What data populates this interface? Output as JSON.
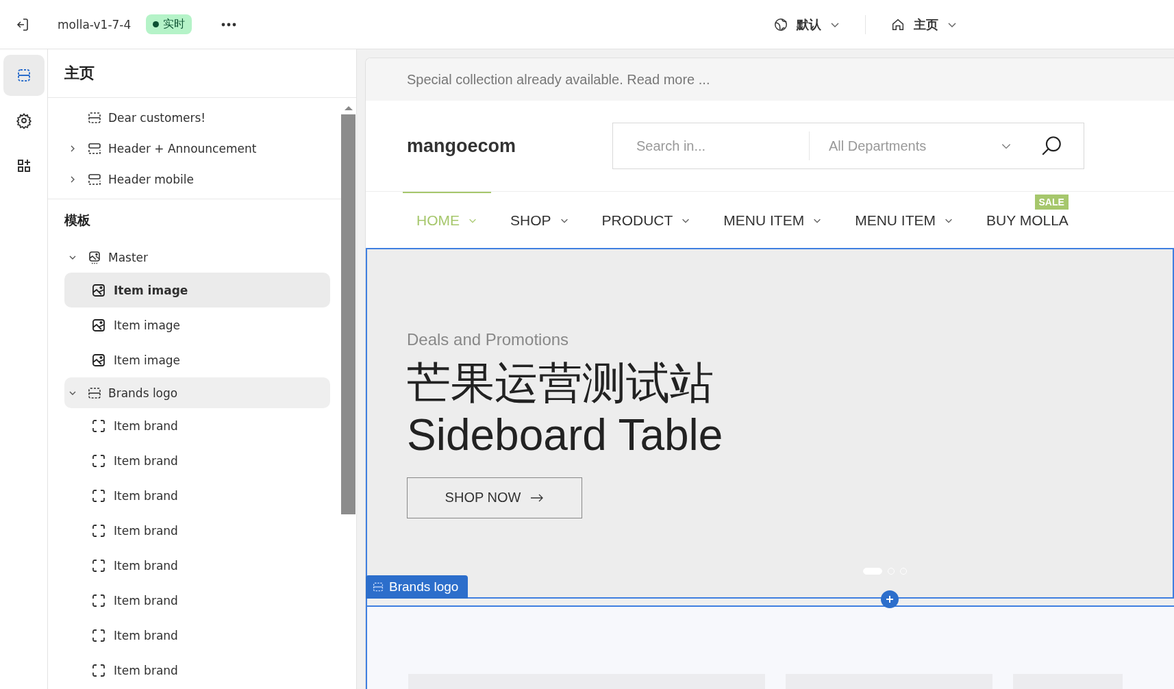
{
  "topbar": {
    "store_name": "molla-v1-7-4",
    "status_badge": "实时",
    "language": "默认",
    "page": "主页"
  },
  "rail": [
    {
      "kind": "sections",
      "selected": true
    },
    {
      "kind": "settings",
      "selected": false
    },
    {
      "kind": "apps",
      "selected": false
    }
  ],
  "sidebar": {
    "title": "主页",
    "sections": [
      {
        "items": [
          {
            "label": "Dear customers!",
            "kind": "section",
            "selected": false
          },
          {
            "label": "Header + Announcement",
            "kind": "header",
            "expanded": false,
            "selected": false
          },
          {
            "label": "Header mobile",
            "kind": "header",
            "expanded": false,
            "selected": false
          }
        ]
      },
      {
        "title": "模板",
        "items": [
          {
            "label": "Master",
            "kind": "master",
            "expanded": true,
            "selected": false,
            "children": [
              {
                "label": "Item image",
                "kind": "image",
                "selected": true
              },
              {
                "label": "Item image",
                "kind": "image",
                "selected": false
              },
              {
                "label": "Item image",
                "kind": "image",
                "selected": false
              }
            ]
          },
          {
            "label": "Brands logo",
            "kind": "section",
            "expanded": true,
            "selected": false,
            "highlighted": true,
            "children": [
              {
                "label": "Item brand",
                "kind": "brand",
                "selected": false
              },
              {
                "label": "Item brand",
                "kind": "brand",
                "selected": false
              },
              {
                "label": "Item brand",
                "kind": "brand",
                "selected": false
              },
              {
                "label": "Item brand",
                "kind": "brand",
                "selected": false
              },
              {
                "label": "Item brand",
                "kind": "brand",
                "selected": false
              },
              {
                "label": "Item brand",
                "kind": "brand",
                "selected": false
              },
              {
                "label": "Item brand",
                "kind": "brand",
                "selected": false
              },
              {
                "label": "Item brand",
                "kind": "brand",
                "selected": false
              }
            ]
          }
        ]
      }
    ]
  },
  "preview": {
    "announcement": "Special collection already available. Read more ...",
    "logo": "mangoecom",
    "search": {
      "placeholder": "Search in...",
      "department": "All Departments"
    },
    "nav": [
      {
        "label": "HOME",
        "selected": true,
        "dropdown": true
      },
      {
        "label": "SHOP",
        "selected": false,
        "dropdown": true
      },
      {
        "label": "PRODUCT",
        "selected": false,
        "dropdown": true
      },
      {
        "label": "MENU ITEM",
        "selected": false,
        "dropdown": true
      },
      {
        "label": "MENU ITEM",
        "selected": false,
        "dropdown": true
      },
      {
        "label": "BUY MOLLA",
        "selected": false,
        "dropdown": false,
        "badge": "SALE"
      }
    ],
    "hero": {
      "subtitle": "Deals and Promotions",
      "title_line_1": "芒果运营测试站",
      "title_line_2": "Sideboard Table",
      "button": "SHOP NOW",
      "dots": [
        {
          "selected": true
        },
        {
          "selected": false
        },
        {
          "selected": false
        }
      ]
    },
    "section_tag": "Brands logo"
  }
}
